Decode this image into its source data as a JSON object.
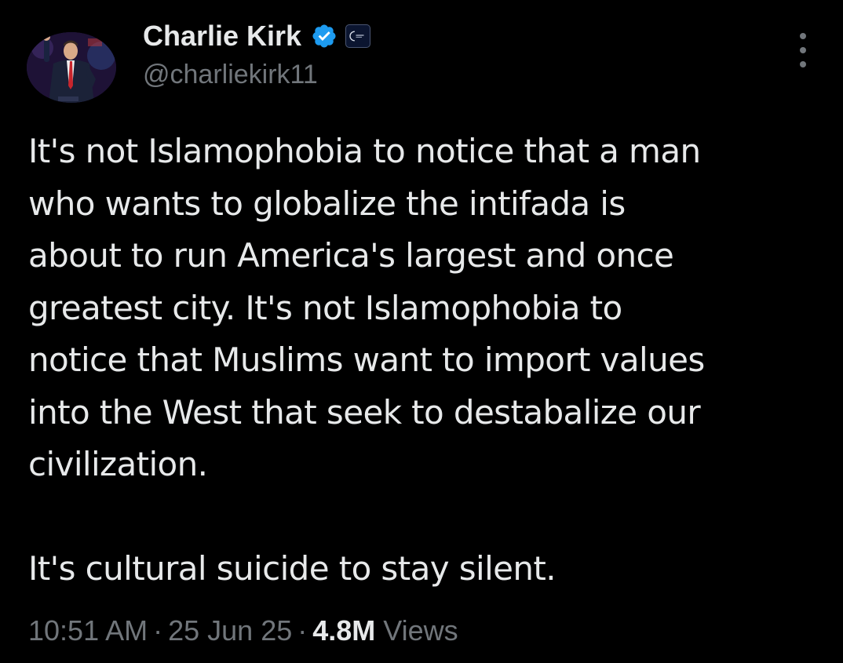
{
  "author": {
    "display_name": "Charlie Kirk",
    "handle": "@charliekirk11",
    "verified_badge_color": "#1d9bf0"
  },
  "tweet": {
    "paragraph_1": "It's not Islamophobia to notice that a man\nwho wants to globalize the intifada is\nabout to run America's largest and once\ngreatest city. It's not Islamophobia to\nnotice that Muslims want to import values\ninto the West that seek to destabalize our\ncivilization.",
    "paragraph_2": "It's cultural suicide to stay silent."
  },
  "meta": {
    "time": "10:51 AM",
    "separator": "·",
    "date": "25 Jun 25",
    "views_count": "4.8M",
    "views_label": "Views"
  },
  "icons": {
    "avatar": "profile-photo",
    "verified": "verified-badge-icon",
    "affiliation": "affiliation-badge-icon",
    "more": "more-options-icon"
  },
  "colors": {
    "background": "#000000",
    "primary_text": "#e7e9ea",
    "secondary_text": "#71767b"
  }
}
